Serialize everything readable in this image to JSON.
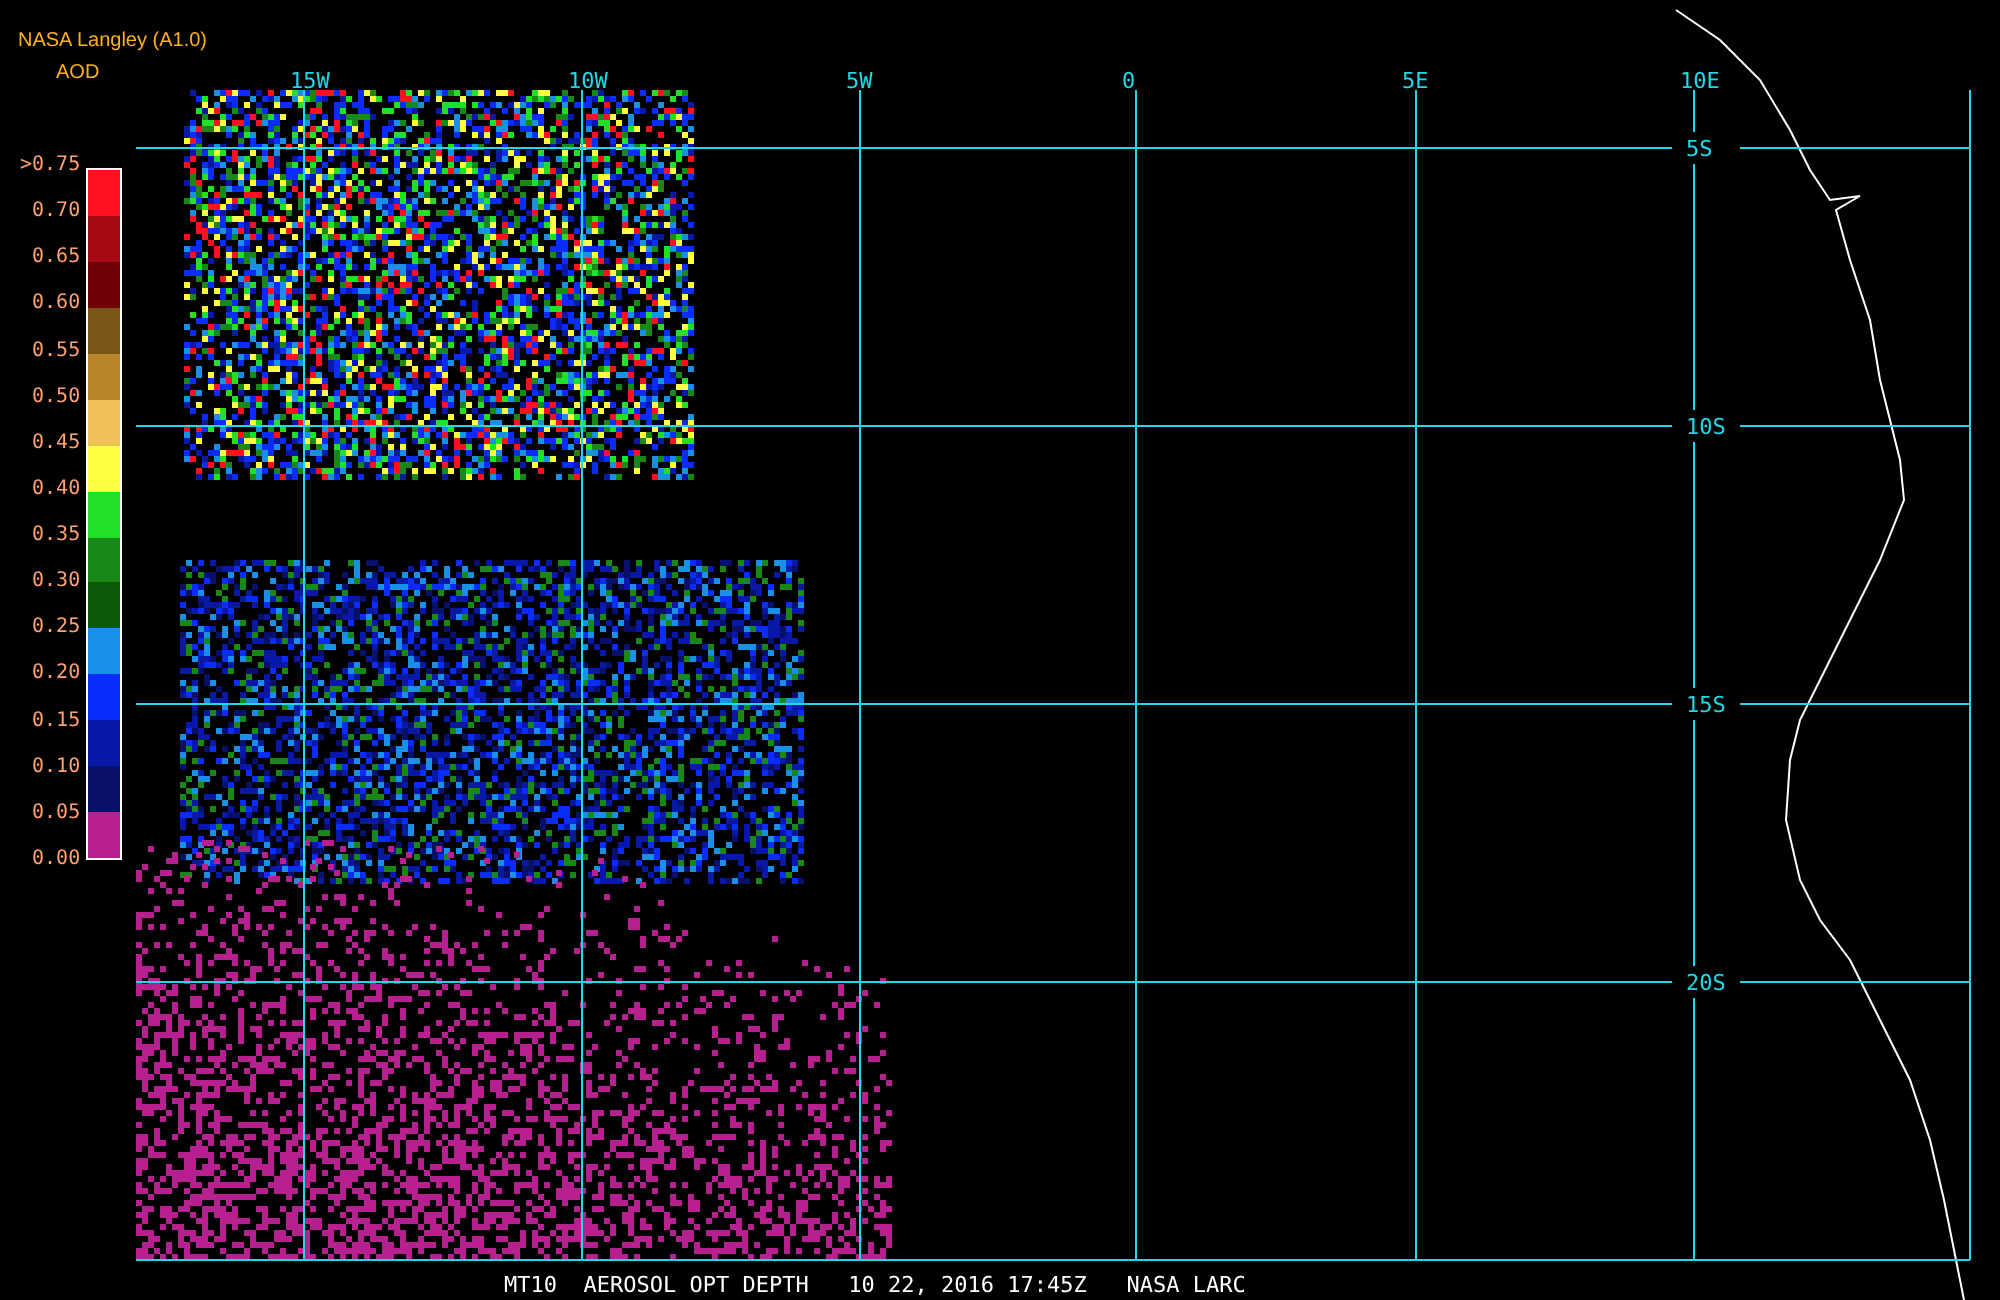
{
  "title": "NASA Langley (A1.0)",
  "subtitle": "AOD",
  "legend": {
    "labels": [
      ">0.75",
      "0.70",
      "0.65",
      "0.60",
      "0.55",
      "0.50",
      "0.45",
      "0.40",
      "0.35",
      "0.30",
      "0.25",
      "0.20",
      "0.15",
      "0.10",
      "0.05",
      "0.00"
    ],
    "steps": [
      {
        "color": "#ff1020"
      },
      {
        "color": "#a80a14"
      },
      {
        "color": "#700008"
      },
      {
        "color": "#7a5518"
      },
      {
        "color": "#b8862a"
      },
      {
        "color": "#f0c058"
      },
      {
        "color": "#ffff40"
      },
      {
        "color": "#20e028"
      },
      {
        "color": "#188818"
      },
      {
        "color": "#0a5a0a"
      },
      {
        "color": "#1890e8"
      },
      {
        "color": "#0a2cff"
      },
      {
        "color": "#0a18a8"
      },
      {
        "color": "#08106a"
      },
      {
        "color": "#b82090"
      }
    ]
  },
  "map": {
    "lon_labels": [
      "15W",
      "10W",
      "5W",
      "0",
      "5E",
      "10E"
    ],
    "lat_labels": [
      "5S",
      "10S",
      "15S",
      "20S"
    ]
  },
  "caption": "MT10  AEROSOL OPT DEPTH   10 22, 2016 17:45Z   NASA LARC"
}
